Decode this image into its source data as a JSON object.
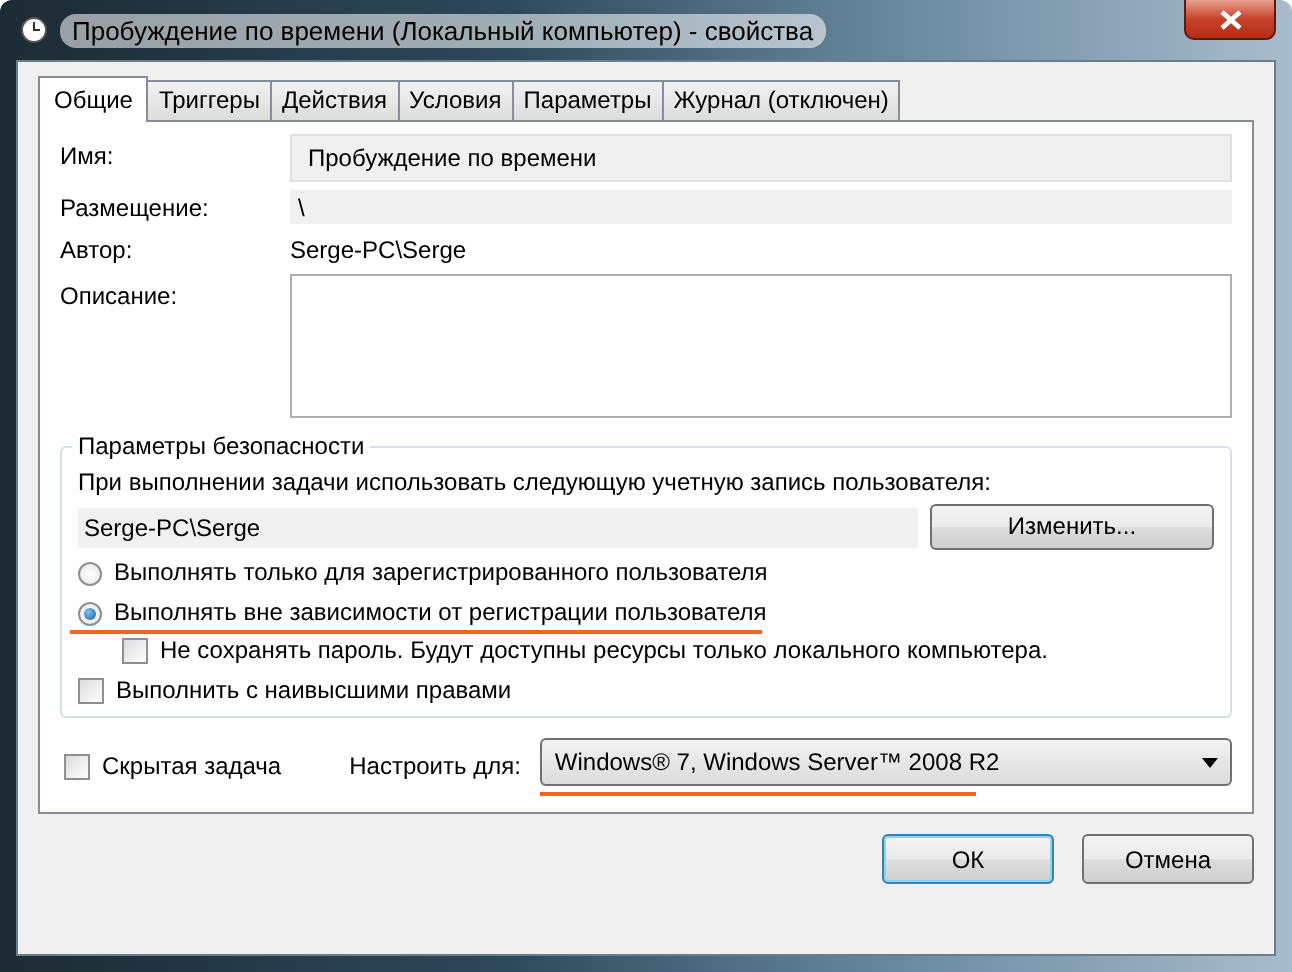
{
  "window": {
    "title": "Пробуждение по времени (Локальный компьютер) - свойства"
  },
  "tabs": [
    {
      "label": "Общие",
      "selected": true
    },
    {
      "label": "Триггеры",
      "selected": false
    },
    {
      "label": "Действия",
      "selected": false
    },
    {
      "label": "Условия",
      "selected": false
    },
    {
      "label": "Параметры",
      "selected": false
    },
    {
      "label": "Журнал (отключен)",
      "selected": false
    }
  ],
  "fields": [
    {
      "kind": "field",
      "label": "Имя:",
      "value": "Пробуждение по времени"
    },
    {
      "kind": "strip",
      "label": "Размещение:",
      "value": "\\"
    },
    {
      "kind": "plain",
      "label": "Автор:",
      "value": "Serge-PC\\Serge"
    },
    {
      "kind": "textarea",
      "label": "Описание:"
    }
  ],
  "security": {
    "title": "Параметры безопасности",
    "prompt": "При выполнении задачи использовать следующую учетную запись пользователя:",
    "account": "Serge-PC\\Serge",
    "change_button": "Изменить...",
    "options": [
      {
        "kind": "radio",
        "label": "Выполнять только для зарегистрированного пользователя",
        "selected": false,
        "highlighted": false
      },
      {
        "kind": "radio",
        "label": "Выполнять вне зависимости от регистрации пользователя",
        "selected": true,
        "highlighted": true,
        "children": [
          {
            "kind": "checkbox",
            "label": "Не сохранять пароль. Будут доступны ресурсы только локального компьютера.",
            "checked": false
          }
        ]
      },
      {
        "kind": "checkbox",
        "label": "Выполнить с наивысшими правами",
        "checked": false
      }
    ]
  },
  "hidden_task": {
    "label": "Скрытая задача",
    "checked": false
  },
  "configure": {
    "label": "Настроить для:",
    "value": "Windows® 7, Windows Server™ 2008 R2",
    "highlighted": true
  },
  "buttons": [
    {
      "label": "ОК",
      "default": true
    },
    {
      "label": "Отмена",
      "default": false
    }
  ]
}
